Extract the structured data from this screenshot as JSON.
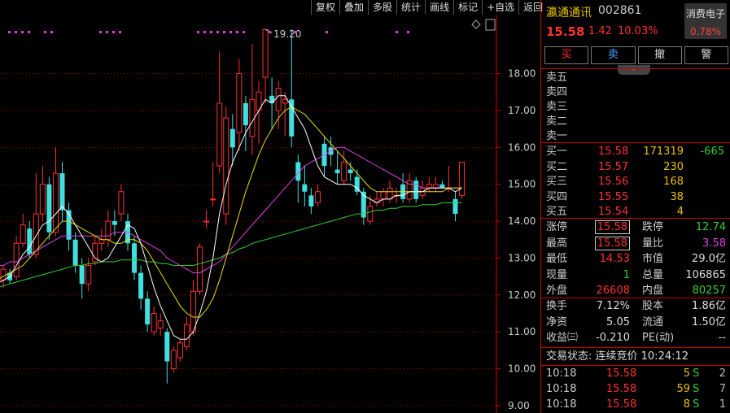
{
  "toolbar": [
    "复权",
    "叠加",
    "多股",
    "统计",
    "画线",
    "标记",
    "+自选",
    "返回"
  ],
  "stock": {
    "name": "瀛通通讯",
    "code": "002861",
    "sector": "消费电子",
    "sector_pct": "0.78%",
    "price": "15.58",
    "change": "1.42",
    "change_pct": "10.03%"
  },
  "buttons": [
    "买",
    "卖",
    "撤",
    "警"
  ],
  "sell_levels": [
    {
      "label": "卖五",
      "price": "",
      "vol": ""
    },
    {
      "label": "卖四",
      "price": "",
      "vol": ""
    },
    {
      "label": "卖三",
      "price": "",
      "vol": ""
    },
    {
      "label": "卖二",
      "price": "",
      "vol": ""
    },
    {
      "label": "卖一",
      "price": "",
      "vol": ""
    }
  ],
  "buy_levels": [
    {
      "label": "买一",
      "price": "15.58",
      "vol": "171319",
      "delta": "-665"
    },
    {
      "label": "买二",
      "price": "15.57",
      "vol": "230",
      "delta": ""
    },
    {
      "label": "买三",
      "price": "15.56",
      "vol": "168",
      "delta": ""
    },
    {
      "label": "买四",
      "price": "15.55",
      "vol": "38",
      "delta": ""
    },
    {
      "label": "买五",
      "price": "15.54",
      "vol": "4",
      "delta": ""
    }
  ],
  "quote": [
    {
      "l": "涨停",
      "v": "15.58",
      "vc": "#ff3030",
      "boxed": true,
      "l2": "跌停",
      "v2": "12.74",
      "v2c": "#30d030"
    },
    {
      "l": "最高",
      "v": "15.58",
      "vc": "#ff3030",
      "boxed": true,
      "l2": "量比",
      "v2": "3.58",
      "v2c": "#e040e0"
    },
    {
      "l": "最低",
      "v": "14.53",
      "vc": "#ff3030",
      "boxed": false,
      "l2": "市值",
      "v2": "29.0亿",
      "v2c": "#ddd"
    },
    {
      "l": "现量",
      "v": "1",
      "vc": "#30d030",
      "boxed": false,
      "l2": "总量",
      "v2": "106865",
      "v2c": "#ddd"
    },
    {
      "l": "外盘",
      "v": "26608",
      "vc": "#ff3030",
      "boxed": false,
      "l2": "内盘",
      "v2": "80257",
      "v2c": "#30d030"
    }
  ],
  "finance": [
    {
      "l": "换手",
      "v": "7.12%",
      "l2": "股本",
      "v2": "1.86亿"
    },
    {
      "l": "净资",
      "v": "5.05",
      "l2": "流通",
      "v2": "1.50亿"
    },
    {
      "l": "收益㈢",
      "v": "-0.210",
      "l2": "PE(动)",
      "v2": "--"
    }
  ],
  "trade_status": "交易状态: 连续竞价 10:24:12",
  "ticks": [
    {
      "t": "10:18",
      "p": "15.58",
      "v": "5",
      "d": "S",
      "n": "2"
    },
    {
      "t": "10:18",
      "p": "15.58",
      "v": "59",
      "d": "S",
      "n": "7"
    },
    {
      "t": "10:18",
      "p": "15.58",
      "v": "8",
      "d": "S",
      "n": "1"
    }
  ],
  "colors": {
    "up": "#ff3030",
    "down": "#40e0e0",
    "ma5": "#ffffff",
    "ma10": "#e8e000",
    "ma20": "#e040e0",
    "ma60": "#30d030",
    "grid": "#a00000"
  },
  "chart_data": {
    "type": "candlestick",
    "y_ticks": [
      "18.00",
      "17.00",
      "16.00",
      "15.00",
      "14.00",
      "13.00",
      "12.00",
      "11.00",
      "10.00",
      "9.00"
    ],
    "ylim": [
      8.8,
      19.6
    ],
    "annotation": "19.20",
    "candles": [
      {
        "o": 12.2,
        "c": 12.5,
        "h": 12.6,
        "l": 11.9
      },
      {
        "o": 12.4,
        "c": 12.7,
        "h": 12.8,
        "l": 12.2
      },
      {
        "o": 12.6,
        "c": 12.4,
        "h": 12.7,
        "l": 12.3
      },
      {
        "o": 12.5,
        "c": 13.4,
        "h": 13.6,
        "l": 12.4
      },
      {
        "o": 13.4,
        "c": 13.9,
        "h": 14.2,
        "l": 13.3
      },
      {
        "o": 13.8,
        "c": 13.1,
        "h": 14.0,
        "l": 13.0
      },
      {
        "o": 13.1,
        "c": 14.2,
        "h": 15.3,
        "l": 13.0
      },
      {
        "o": 14.2,
        "c": 15.0,
        "h": 15.5,
        "l": 14.0
      },
      {
        "o": 15.0,
        "c": 13.7,
        "h": 15.2,
        "l": 13.5
      },
      {
        "o": 13.7,
        "c": 15.3,
        "h": 16.0,
        "l": 13.6
      },
      {
        "o": 15.3,
        "c": 14.3,
        "h": 15.6,
        "l": 14.0
      },
      {
        "o": 14.3,
        "c": 13.5,
        "h": 14.5,
        "l": 13.2
      },
      {
        "o": 13.5,
        "c": 12.8,
        "h": 13.7,
        "l": 12.6
      },
      {
        "o": 12.8,
        "c": 12.3,
        "h": 13.0,
        "l": 11.9
      },
      {
        "o": 12.3,
        "c": 12.8,
        "h": 13.0,
        "l": 12.1
      },
      {
        "o": 12.9,
        "c": 13.4,
        "h": 13.6,
        "l": 12.8
      },
      {
        "o": 13.4,
        "c": 13.5,
        "h": 13.8,
        "l": 13.2
      },
      {
        "o": 13.5,
        "c": 14.0,
        "h": 14.3,
        "l": 13.3
      },
      {
        "o": 14.0,
        "c": 13.9,
        "h": 14.3,
        "l": 13.6
      },
      {
        "o": 14.2,
        "c": 14.8,
        "h": 15.0,
        "l": 14.0
      },
      {
        "o": 14.0,
        "c": 13.4,
        "h": 14.2,
        "l": 13.2
      },
      {
        "o": 13.4,
        "c": 12.6,
        "h": 13.6,
        "l": 12.4
      },
      {
        "o": 12.6,
        "c": 11.9,
        "h": 12.8,
        "l": 11.6
      },
      {
        "o": 11.9,
        "c": 11.2,
        "h": 12.1,
        "l": 11.0
      },
      {
        "o": 11.0,
        "c": 11.5,
        "h": 11.7,
        "l": 10.9
      },
      {
        "o": 11.1,
        "c": 11.3,
        "h": 11.5,
        "l": 10.9
      },
      {
        "o": 11.0,
        "c": 10.2,
        "h": 11.1,
        "l": 9.6
      },
      {
        "o": 10.0,
        "c": 10.5,
        "h": 10.6,
        "l": 9.9
      },
      {
        "o": 10.3,
        "c": 10.7,
        "h": 10.8,
        "l": 10.2
      },
      {
        "o": 10.6,
        "c": 11.2,
        "h": 11.4,
        "l": 10.5
      },
      {
        "o": 11.0,
        "c": 12.1,
        "h": 12.4,
        "l": 10.9
      },
      {
        "o": 12.1,
        "c": 13.3,
        "h": 13.4,
        "l": 12.0
      },
      {
        "o": 14.0,
        "c": 14.0,
        "h": 14.3,
        "l": 13.8
      },
      {
        "o": 14.6,
        "c": 14.6,
        "h": 15.6,
        "l": 14.4
      },
      {
        "o": 15.5,
        "c": 17.2,
        "h": 18.6,
        "l": 15.3
      },
      {
        "o": 14.2,
        "c": 16.8,
        "h": 17.1,
        "l": 13.9
      },
      {
        "o": 16.5,
        "c": 16.0,
        "h": 16.9,
        "l": 15.5
      },
      {
        "o": 16.4,
        "c": 18.0,
        "h": 18.4,
        "l": 15.9
      },
      {
        "o": 17.2,
        "c": 16.6,
        "h": 17.4,
        "l": 15.9
      },
      {
        "o": 16.3,
        "c": 17.3,
        "h": 18.8,
        "l": 15.8
      },
      {
        "o": 17.0,
        "c": 17.5,
        "h": 17.8,
        "l": 16.1
      },
      {
        "o": 17.9,
        "c": 19.2,
        "h": 19.2,
        "l": 17.2
      },
      {
        "o": 17.4,
        "c": 17.2,
        "h": 17.9,
        "l": 16.5
      },
      {
        "o": 17.0,
        "c": 17.6,
        "h": 17.8,
        "l": 16.5
      },
      {
        "o": 17.2,
        "c": 17.3,
        "h": 17.5,
        "l": 16.3
      },
      {
        "o": 17.3,
        "c": 16.3,
        "h": 19.2,
        "l": 16.0
      },
      {
        "o": 15.6,
        "c": 15.1,
        "h": 15.8,
        "l": 14.5
      },
      {
        "o": 15.0,
        "c": 14.8,
        "h": 15.5,
        "l": 14.4
      },
      {
        "o": 14.7,
        "c": 14.4,
        "h": 14.9,
        "l": 14.2
      },
      {
        "o": 14.5,
        "c": 14.8,
        "h": 15.0,
        "l": 14.4
      },
      {
        "o": 16.1,
        "c": 15.5,
        "h": 16.3,
        "l": 15.2
      },
      {
        "o": 16.0,
        "c": 15.8,
        "h": 16.3,
        "l": 15.5
      },
      {
        "o": 15.4,
        "c": 15.3,
        "h": 15.9,
        "l": 15.0
      },
      {
        "o": 15.1,
        "c": 15.6,
        "h": 15.9,
        "l": 15.0
      },
      {
        "o": 15.4,
        "c": 15.3,
        "h": 15.6,
        "l": 15.1
      },
      {
        "o": 15.2,
        "c": 14.8,
        "h": 15.4,
        "l": 14.7
      },
      {
        "o": 14.8,
        "c": 14.1,
        "h": 14.9,
        "l": 13.9
      },
      {
        "o": 14.0,
        "c": 14.4,
        "h": 14.7,
        "l": 13.9
      },
      {
        "o": 14.5,
        "c": 14.6,
        "h": 14.8,
        "l": 14.4
      },
      {
        "o": 14.6,
        "c": 14.8,
        "h": 14.9,
        "l": 14.4
      },
      {
        "o": 14.6,
        "c": 14.9,
        "h": 15.1,
        "l": 14.5
      },
      {
        "o": 14.7,
        "c": 14.7,
        "h": 14.9,
        "l": 14.5
      },
      {
        "o": 15.0,
        "c": 14.6,
        "h": 15.3,
        "l": 14.5
      },
      {
        "o": 14.6,
        "c": 15.1,
        "h": 15.3,
        "l": 14.5
      },
      {
        "o": 15.1,
        "c": 14.6,
        "h": 15.2,
        "l": 14.5
      },
      {
        "o": 14.7,
        "c": 14.9,
        "h": 15.1,
        "l": 14.6
      },
      {
        "o": 14.9,
        "c": 15.0,
        "h": 15.2,
        "l": 14.8
      },
      {
        "o": 14.9,
        "c": 15.0,
        "h": 15.2,
        "l": 14.8
      },
      {
        "o": 15.0,
        "c": 14.9,
        "h": 15.1,
        "l": 14.9
      },
      {
        "o": 14.9,
        "c": 14.9,
        "h": 15.5,
        "l": 14.8
      },
      {
        "o": 14.6,
        "c": 14.2,
        "h": 14.8,
        "l": 14.0
      },
      {
        "o": 14.7,
        "c": 15.6,
        "h": 15.6,
        "l": 14.6
      }
    ],
    "ma5": [
      12.3,
      12.4,
      12.5,
      12.8,
      13.1,
      13.3,
      13.6,
      13.9,
      14.0,
      14.2,
      14.4,
      14.2,
      13.9,
      13.6,
      13.3,
      13.0,
      12.9,
      13.0,
      13.3,
      13.6,
      13.9,
      13.8,
      13.4,
      12.8,
      12.2,
      11.7,
      11.3,
      10.9,
      10.8,
      10.8,
      11.0,
      11.5,
      12.1,
      13.0,
      14.2,
      15.0,
      15.6,
      16.0,
      16.4,
      16.7,
      17.0,
      17.3,
      17.2,
      17.4,
      17.4,
      17.1,
      16.8,
      16.5,
      16.0,
      15.5,
      15.2,
      15.1,
      15.0,
      15.0,
      15.0,
      14.9,
      14.7,
      14.6,
      14.5,
      14.6,
      14.6,
      14.7,
      14.7,
      14.8,
      14.8,
      14.8,
      14.9,
      14.9,
      14.9,
      14.9,
      14.8,
      14.9
    ],
    "ma10": [
      12.4,
      12.5,
      12.6,
      12.7,
      12.8,
      13.0,
      13.2,
      13.4,
      13.6,
      13.8,
      14.0,
      14.0,
      13.9,
      13.8,
      13.7,
      13.6,
      13.5,
      13.5,
      13.4,
      13.4,
      13.5,
      13.5,
      13.4,
      13.2,
      12.9,
      12.6,
      12.3,
      12.0,
      11.7,
      11.5,
      11.4,
      11.4,
      11.6,
      11.9,
      12.4,
      13.0,
      13.6,
      14.2,
      14.8,
      15.3,
      15.8,
      16.2,
      16.5,
      16.8,
      17.0,
      17.1,
      17.0,
      16.9,
      16.7,
      16.5,
      16.3,
      16.1,
      15.9,
      15.7,
      15.5,
      15.3,
      15.1,
      14.9,
      14.8,
      14.8,
      14.8,
      14.8,
      14.8,
      14.8,
      14.8,
      14.8,
      14.8,
      14.8,
      14.8,
      14.9,
      14.9,
      14.9
    ],
    "ma20": [
      12.8,
      12.8,
      12.9,
      12.9,
      13.0,
      13.1,
      13.2,
      13.3,
      13.4,
      13.5,
      13.6,
      13.6,
      13.6,
      13.6,
      13.6,
      13.6,
      13.6,
      13.6,
      13.7,
      13.7,
      13.7,
      13.6,
      13.5,
      13.4,
      13.3,
      13.2,
      13.0,
      12.9,
      12.8,
      12.7,
      12.6,
      12.6,
      12.7,
      12.8,
      12.9,
      13.1,
      13.3,
      13.5,
      13.7,
      13.9,
      14.1,
      14.3,
      14.5,
      14.7,
      14.9,
      15.1,
      15.3,
      15.5,
      15.6,
      15.7,
      15.8,
      15.9,
      16.0,
      16.0,
      15.9,
      15.8,
      15.7,
      15.6,
      15.5,
      15.4,
      15.3,
      15.2,
      15.1,
      15.0,
      15.0,
      14.9,
      14.9,
      14.9,
      14.9,
      14.9,
      14.9,
      14.9
    ],
    "ma60": [
      12.2,
      12.25,
      12.3,
      12.35,
      12.4,
      12.45,
      12.5,
      12.55,
      12.6,
      12.65,
      12.7,
      12.75,
      12.8,
      12.8,
      12.85,
      12.85,
      12.9,
      12.9,
      12.9,
      12.95,
      12.95,
      12.95,
      12.95,
      12.9,
      12.9,
      12.85,
      12.85,
      12.8,
      12.8,
      12.8,
      12.8,
      12.85,
      12.9,
      12.95,
      13.0,
      13.1,
      13.15,
      13.25,
      13.3,
      13.4,
      13.45,
      13.5,
      13.55,
      13.6,
      13.65,
      13.7,
      13.75,
      13.8,
      13.85,
      13.9,
      13.95,
      14.0,
      14.05,
      14.1,
      14.15,
      14.2,
      14.2,
      14.25,
      14.3,
      14.3,
      14.35,
      14.35,
      14.4,
      14.4,
      14.4,
      14.45,
      14.45,
      14.45,
      14.5,
      14.5,
      14.5,
      14.5
    ]
  }
}
